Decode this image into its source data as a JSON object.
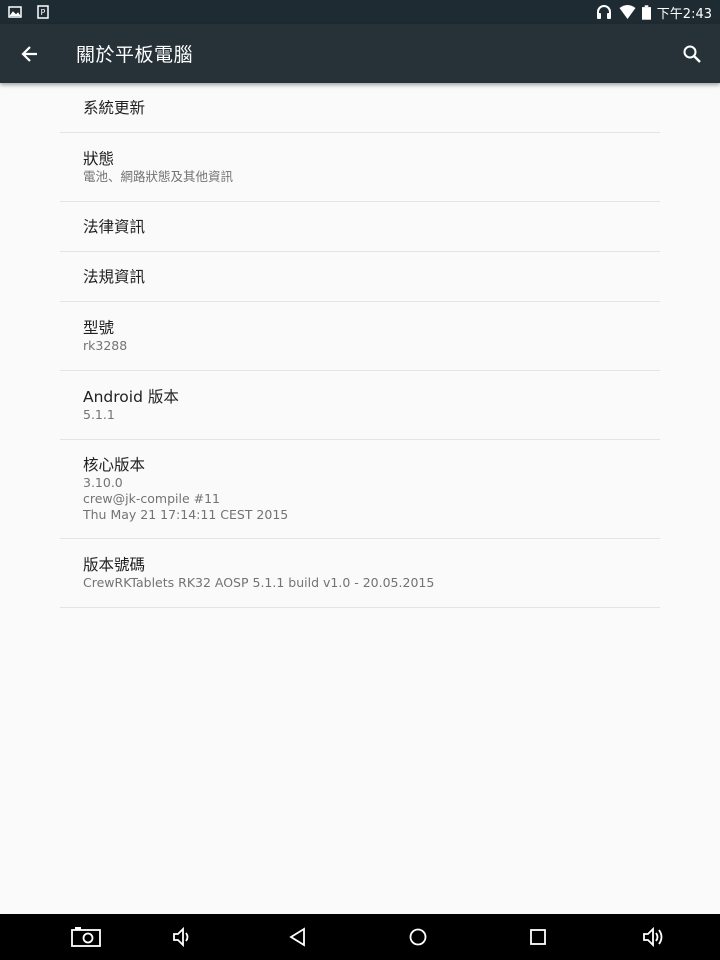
{
  "status_bar": {
    "time": "下午2:43",
    "left_icons": [
      "image-icon",
      "parking-icon"
    ],
    "right_icons": [
      "headset-icon",
      "wifi-icon",
      "battery-icon"
    ]
  },
  "toolbar": {
    "title": "關於平板電腦",
    "back_icon": "arrow-left-icon",
    "search_icon": "search-icon"
  },
  "items": [
    {
      "title": "系統更新",
      "subtitles": []
    },
    {
      "title": "狀態",
      "subtitles": [
        "電池、網路狀態及其他資訊"
      ]
    },
    {
      "title": "法律資訊",
      "subtitles": []
    },
    {
      "title": "法規資訊",
      "subtitles": []
    },
    {
      "title": "型號",
      "subtitles": [
        "rk3288"
      ]
    },
    {
      "title": "Android 版本",
      "subtitles": [
        "5.1.1"
      ]
    },
    {
      "title": "核心版本",
      "subtitles": [
        "3.10.0",
        "crew@jk-compile #11",
        "Thu May 21 17:14:11 CEST 2015"
      ]
    },
    {
      "title": "版本號碼",
      "subtitles": [
        "CrewRKTablets RK32 AOSP 5.1.1 build v1.0 - 20.05.2015"
      ]
    }
  ],
  "nav_bar": {
    "icons": [
      "screenshot-icon",
      "volume-down-icon",
      "back-triangle-icon",
      "home-circle-icon",
      "recents-square-icon",
      "volume-up-icon"
    ]
  },
  "colors": {
    "toolbar": "#263238",
    "status_bar": "#1f2b32",
    "background": "#fafafa",
    "divider": "#e4e4e4",
    "nav_bar": "#000000"
  }
}
